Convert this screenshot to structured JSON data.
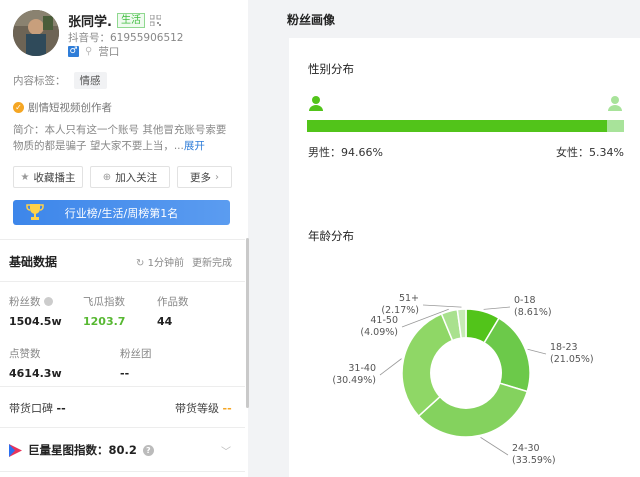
{
  "profile": {
    "name": "张同学.",
    "category_tag": "生活",
    "douyin_id": "抖音号：61955906512",
    "gender_symbol": "♂",
    "location": "营口",
    "content_tag_label": "内容标签：",
    "content_tag": "情感",
    "creator_badge": "剧情短视频创作者",
    "bio": "简介：本人只有这一个账号 其他冒充账号索要物质的都是骗子 望大家不要上当，...",
    "bio_expand": "展开"
  },
  "actions": {
    "favorite_label": "收藏播主",
    "follow_label": "加入关注",
    "more_label": "更多"
  },
  "rank_banner": "行业榜/生活/周榜第1名",
  "basic_data": {
    "title": "基础数据",
    "updated_ago": "1分钟前",
    "update_status": "更新完成",
    "stats": [
      {
        "label": "粉丝数",
        "value": "1504.5w"
      },
      {
        "label": "飞瓜指数",
        "value": "1203.7"
      },
      {
        "label": "作品数",
        "value": "44"
      },
      {
        "label": "点赞数",
        "value": "4614.3w"
      },
      {
        "label": "粉丝团",
        "value": "--"
      }
    ],
    "commerce_reputation_label": "带货口碑",
    "commerce_reputation_value": "--",
    "commerce_level_label": "带货等级",
    "commerce_level_value": "--"
  },
  "xingtu": {
    "label": "巨量星图指数：80.2",
    "help": "?"
  },
  "fan_profile": {
    "title": "粉丝画像",
    "gender": {
      "title": "性别分布",
      "male_label": "男性：94.66%",
      "female_label": "女性：5.34%",
      "male_fraction": 0.9466
    },
    "age_title": "年龄分布"
  },
  "colors": {
    "accent_green": "#52c41a",
    "brand_blue": "#3d86ea"
  },
  "chart_data": {
    "type": "pie",
    "title": "年龄分布",
    "categories": [
      "0-18",
      "18-23",
      "24-30",
      "31-40",
      "41-50",
      "51+"
    ],
    "values": [
      8.61,
      21.05,
      33.59,
      30.49,
      4.09,
      2.17
    ],
    "labels": [
      "8.61%",
      "21.05%",
      "33.59%",
      "30.49%",
      "4.09%",
      "2.17%"
    ],
    "colors": [
      "#52c41a",
      "#6cc94a",
      "#84d25e",
      "#8fd766",
      "#a9e18e",
      "#c6ebb5"
    ],
    "hole": 0.55
  }
}
